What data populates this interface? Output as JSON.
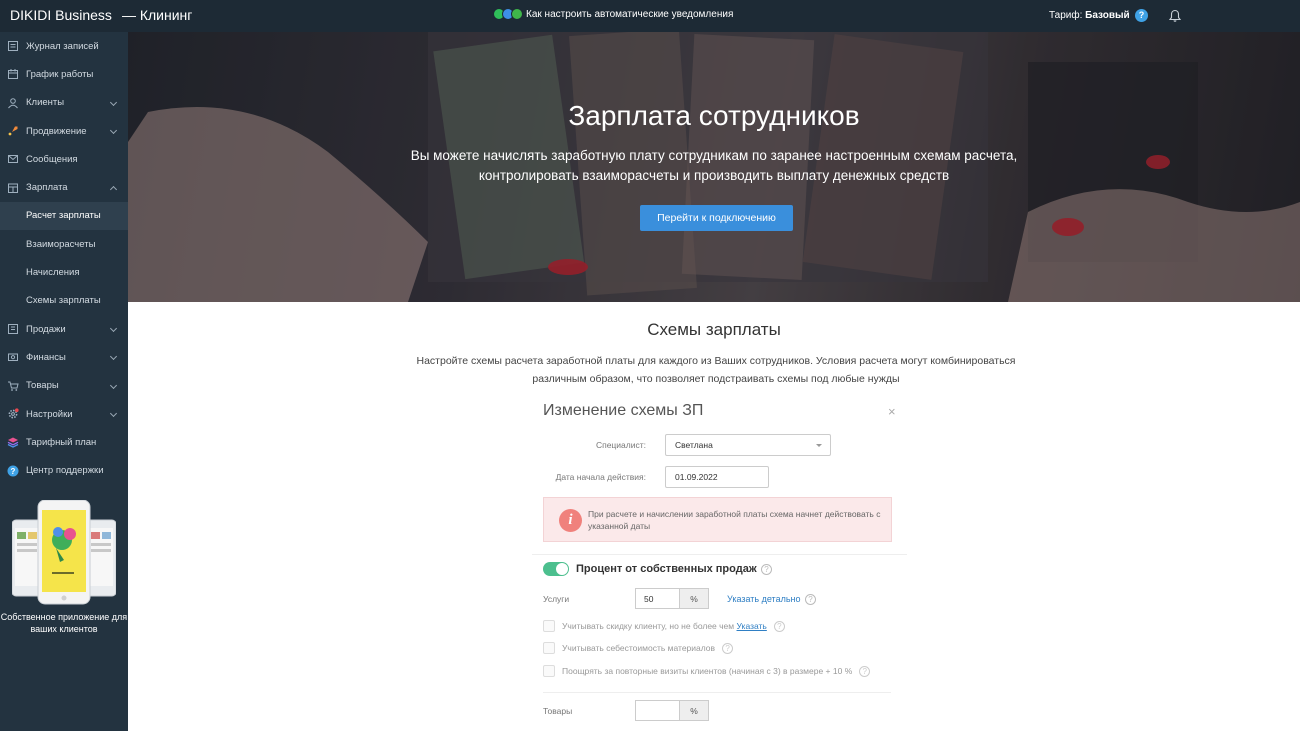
{
  "topbar": {
    "brand": "DIKIDI Business",
    "brand_sub": "— Клининг",
    "notice": "Как настроить автоматические уведомления",
    "tariff_label": "Тариф:",
    "tariff_value": "Базовый",
    "help_label": "?"
  },
  "sidebar": {
    "items": [
      {
        "label": "Журнал записей",
        "icon": "journal-icon"
      },
      {
        "label": "График работы",
        "icon": "calendar-icon"
      },
      {
        "label": "Клиенты",
        "icon": "clients-icon"
      },
      {
        "label": "Продвижение",
        "icon": "rocket-icon"
      },
      {
        "label": "Сообщения",
        "icon": "messages-icon"
      },
      {
        "label": "Зарплата",
        "icon": "salary-icon"
      },
      {
        "label": "Продажи",
        "icon": "sales-icon"
      },
      {
        "label": "Финансы",
        "icon": "finance-icon"
      },
      {
        "label": "Товары",
        "icon": "cart-icon"
      },
      {
        "label": "Настройки",
        "icon": "settings-icon"
      },
      {
        "label": "Тарифный план",
        "icon": "layers-icon"
      },
      {
        "label": "Центр поддержки",
        "icon": "help-icon"
      }
    ],
    "salary_sub": [
      {
        "label": "Расчет зарплаты",
        "active": true
      },
      {
        "label": "Взаиморасчеты"
      },
      {
        "label": "Начисления"
      },
      {
        "label": "Схемы зарплаты"
      }
    ],
    "app_caption": "Собственное приложение для ваших клиентов"
  },
  "hero": {
    "title": "Зарплата сотрудников",
    "text_line1": "Вы можете начислять заработную плату сотрудникам по заранее настроенным схемам расчета,",
    "text_line2": "контролировать взаиморасчеты и производить выплату денежных средств",
    "button": "Перейти к подключению"
  },
  "schemes": {
    "title": "Схемы зарплаты",
    "desc_line1": "Настройте схемы расчета заработной платы для каждого из Ваших сотрудников. Условия расчета могут комбинироваться",
    "desc_line2": "различным образом, что позволяет подстраивать схемы под любые нужды"
  },
  "modal": {
    "title": "Изменение схемы ЗП",
    "close": "×",
    "specialist_label": "Специалист:",
    "specialist_value": "Светлана",
    "start_date_label": "Дата начала действия:",
    "start_date_value": "01.09.2022",
    "alert_icon": "i",
    "alert_text": "При расчете и начислении заработной платы схема начнет действовать с указанной даты",
    "section_title": "Процент от собственных продаж",
    "services_label": "Услуги",
    "services_value": "50",
    "percent_unit": "%",
    "detail_link": "Указать детально",
    "option1_text": "Учитывать скидку клиенту, но не более чем",
    "option1_link": "Указать",
    "option2_text": "Учитывать себестоимость материалов",
    "option3_text": "Поощрять за повторные визиты клиентов (начиная с 3) в размере + 10 %",
    "goods_label": "Товары",
    "goods_value": "",
    "question": "?"
  },
  "colors": {
    "topbar_bg": "#1d2a35",
    "sidebar_bg": "#233340",
    "accent_button": "#3a8fdc",
    "toggle_on": "#4cbf8e",
    "alert_bg": "#fbe9ea",
    "link": "#2f7fc4"
  }
}
